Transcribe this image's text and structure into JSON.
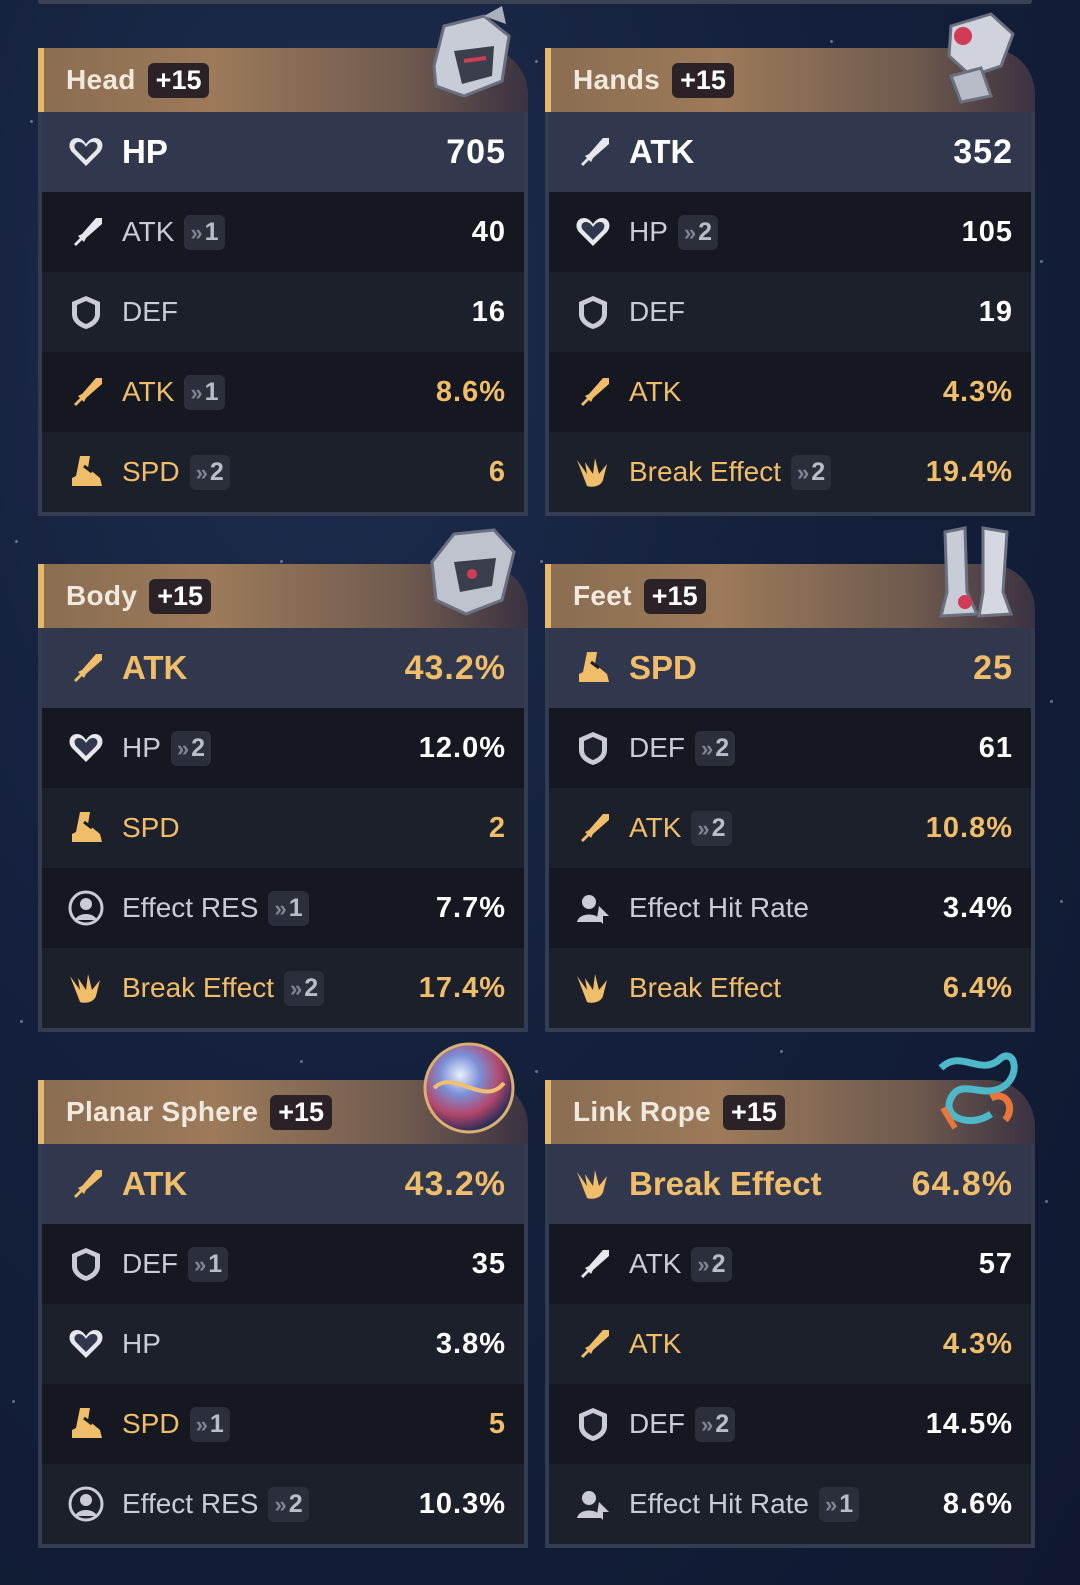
{
  "colors": {
    "gold": "#f0bd6a",
    "header_border": "#e4b86a",
    "row_dark": "#151820",
    "row_light": "#1c202b",
    "main_row": "#31384d"
  },
  "cards": [
    {
      "slot": "Head",
      "level": "+15",
      "piece_icon": "helmet-icon",
      "main": {
        "stat": "HP",
        "icon": "heart-icon",
        "value": "705",
        "gold": false
      },
      "subs": [
        {
          "stat": "ATK",
          "icon": "sword-icon",
          "roll": "1",
          "value": "40",
          "gold": false
        },
        {
          "stat": "DEF",
          "icon": "shield-icon",
          "roll": "",
          "value": "16",
          "gold": false
        },
        {
          "stat": "ATK",
          "icon": "sword-icon",
          "roll": "1",
          "value": "8.6%",
          "gold": true
        },
        {
          "stat": "SPD",
          "icon": "boot-icon",
          "roll": "2",
          "value": "6",
          "gold": true
        }
      ]
    },
    {
      "slot": "Hands",
      "level": "+15",
      "piece_icon": "gauntlet-icon",
      "main": {
        "stat": "ATK",
        "icon": "sword-icon",
        "value": "352",
        "gold": false
      },
      "subs": [
        {
          "stat": "HP",
          "icon": "heart-icon",
          "roll": "2",
          "value": "105",
          "gold": false
        },
        {
          "stat": "DEF",
          "icon": "shield-icon",
          "roll": "",
          "value": "19",
          "gold": false
        },
        {
          "stat": "ATK",
          "icon": "sword-icon",
          "roll": "",
          "value": "4.3%",
          "gold": true
        },
        {
          "stat": "Break Effect",
          "icon": "break-icon",
          "roll": "2",
          "value": "19.4%",
          "gold": true
        }
      ]
    },
    {
      "slot": "Body",
      "level": "+15",
      "piece_icon": "armor-icon",
      "main": {
        "stat": "ATK",
        "icon": "sword-icon",
        "value": "43.2%",
        "gold": true
      },
      "subs": [
        {
          "stat": "HP",
          "icon": "heart-icon",
          "roll": "2",
          "value": "12.0%",
          "gold": false
        },
        {
          "stat": "SPD",
          "icon": "boot-icon",
          "roll": "",
          "value": "2",
          "gold": true
        },
        {
          "stat": "Effect RES",
          "icon": "effect-res-icon",
          "roll": "1",
          "value": "7.7%",
          "gold": false
        },
        {
          "stat": "Break Effect",
          "icon": "break-icon",
          "roll": "2",
          "value": "17.4%",
          "gold": true
        }
      ]
    },
    {
      "slot": "Feet",
      "level": "+15",
      "piece_icon": "boots-icon",
      "main": {
        "stat": "SPD",
        "icon": "boot-icon",
        "value": "25",
        "gold": true
      },
      "subs": [
        {
          "stat": "DEF",
          "icon": "shield-icon",
          "roll": "2",
          "value": "61",
          "gold": false
        },
        {
          "stat": "ATK",
          "icon": "sword-icon",
          "roll": "2",
          "value": "10.8%",
          "gold": true
        },
        {
          "stat": "Effect Hit Rate",
          "icon": "effect-hit-icon",
          "roll": "",
          "value": "3.4%",
          "gold": false
        },
        {
          "stat": "Break Effect",
          "icon": "break-icon",
          "roll": "",
          "value": "6.4%",
          "gold": true
        }
      ]
    },
    {
      "slot": "Planar Sphere",
      "level": "+15",
      "piece_icon": "sphere-icon",
      "main": {
        "stat": "ATK",
        "icon": "sword-icon",
        "value": "43.2%",
        "gold": true
      },
      "subs": [
        {
          "stat": "DEF",
          "icon": "shield-icon",
          "roll": "1",
          "value": "35",
          "gold": false
        },
        {
          "stat": "HP",
          "icon": "heart-icon",
          "roll": "",
          "value": "3.8%",
          "gold": false
        },
        {
          "stat": "SPD",
          "icon": "boot-icon",
          "roll": "1",
          "value": "5",
          "gold": true
        },
        {
          "stat": "Effect RES",
          "icon": "effect-res-icon",
          "roll": "2",
          "value": "10.3%",
          "gold": false
        }
      ]
    },
    {
      "slot": "Link Rope",
      "level": "+15",
      "piece_icon": "rope-icon",
      "main": {
        "stat": "Break Effect",
        "icon": "break-icon",
        "value": "64.8%",
        "gold": true
      },
      "subs": [
        {
          "stat": "ATK",
          "icon": "sword-icon",
          "roll": "2",
          "value": "57",
          "gold": false
        },
        {
          "stat": "ATK",
          "icon": "sword-icon",
          "roll": "",
          "value": "4.3%",
          "gold": true
        },
        {
          "stat": "DEF",
          "icon": "shield-icon",
          "roll": "2",
          "value": "14.5%",
          "gold": false
        },
        {
          "stat": "Effect Hit Rate",
          "icon": "effect-hit-icon",
          "roll": "1",
          "value": "8.6%",
          "gold": false
        }
      ]
    }
  ]
}
